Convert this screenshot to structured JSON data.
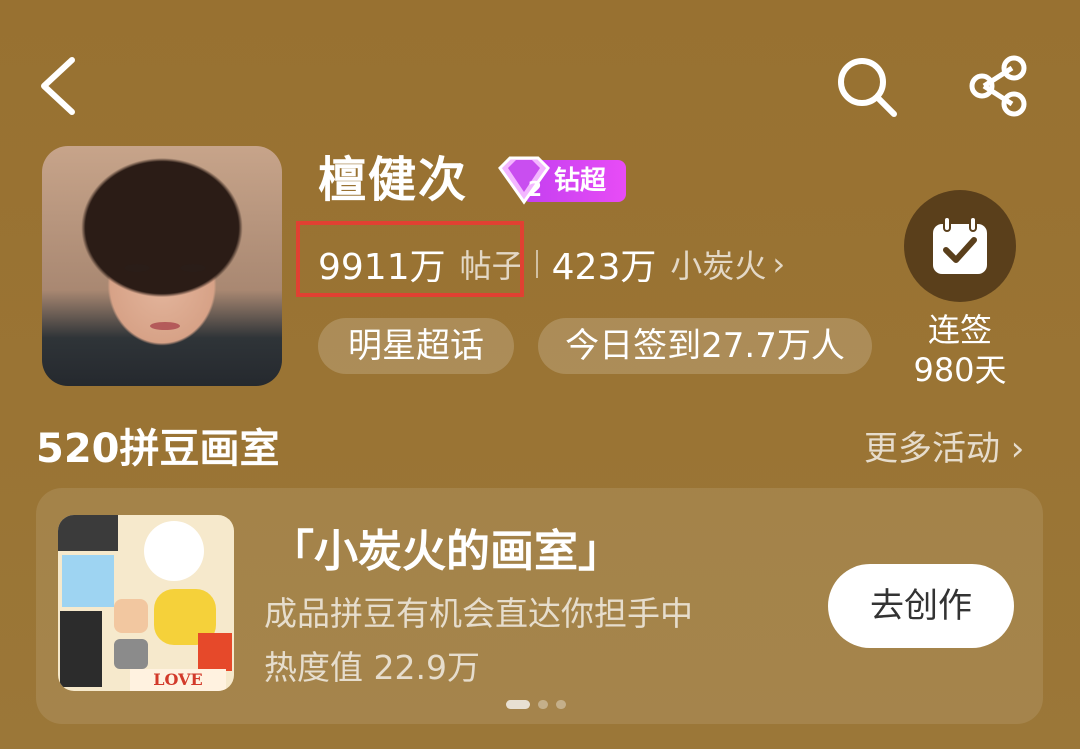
{
  "header": {
    "back_icon": "chevron-left-icon",
    "search_icon": "search-icon",
    "share_icon": "share-icon"
  },
  "profile": {
    "name": "檀健次",
    "badge_label": "钻超",
    "badge_level": "2",
    "posts_count": "9911万",
    "posts_label": "帖子",
    "fans_count": "423万",
    "fans_label": "小炭火",
    "fans_chevron": "›",
    "tags": [
      "明星超话",
      "今日签到27.7万人"
    ]
  },
  "checkin": {
    "line1": "连签",
    "line2": "980天",
    "icon": "calendar-check-icon"
  },
  "section": {
    "title": "520拼豆画室",
    "more": "更多活动 ›"
  },
  "card": {
    "title": "「小炭火的画室」",
    "subtitle": "成品拼豆有机会直达你担手中",
    "heat": "热度值 22.9万",
    "button": "去创作",
    "thumb_text": "LOVE",
    "carousel_pages": 3,
    "carousel_active": 0
  },
  "colors": {
    "background": "#9a7434",
    "highlight": "#e14032",
    "badge": "#d845f3"
  }
}
